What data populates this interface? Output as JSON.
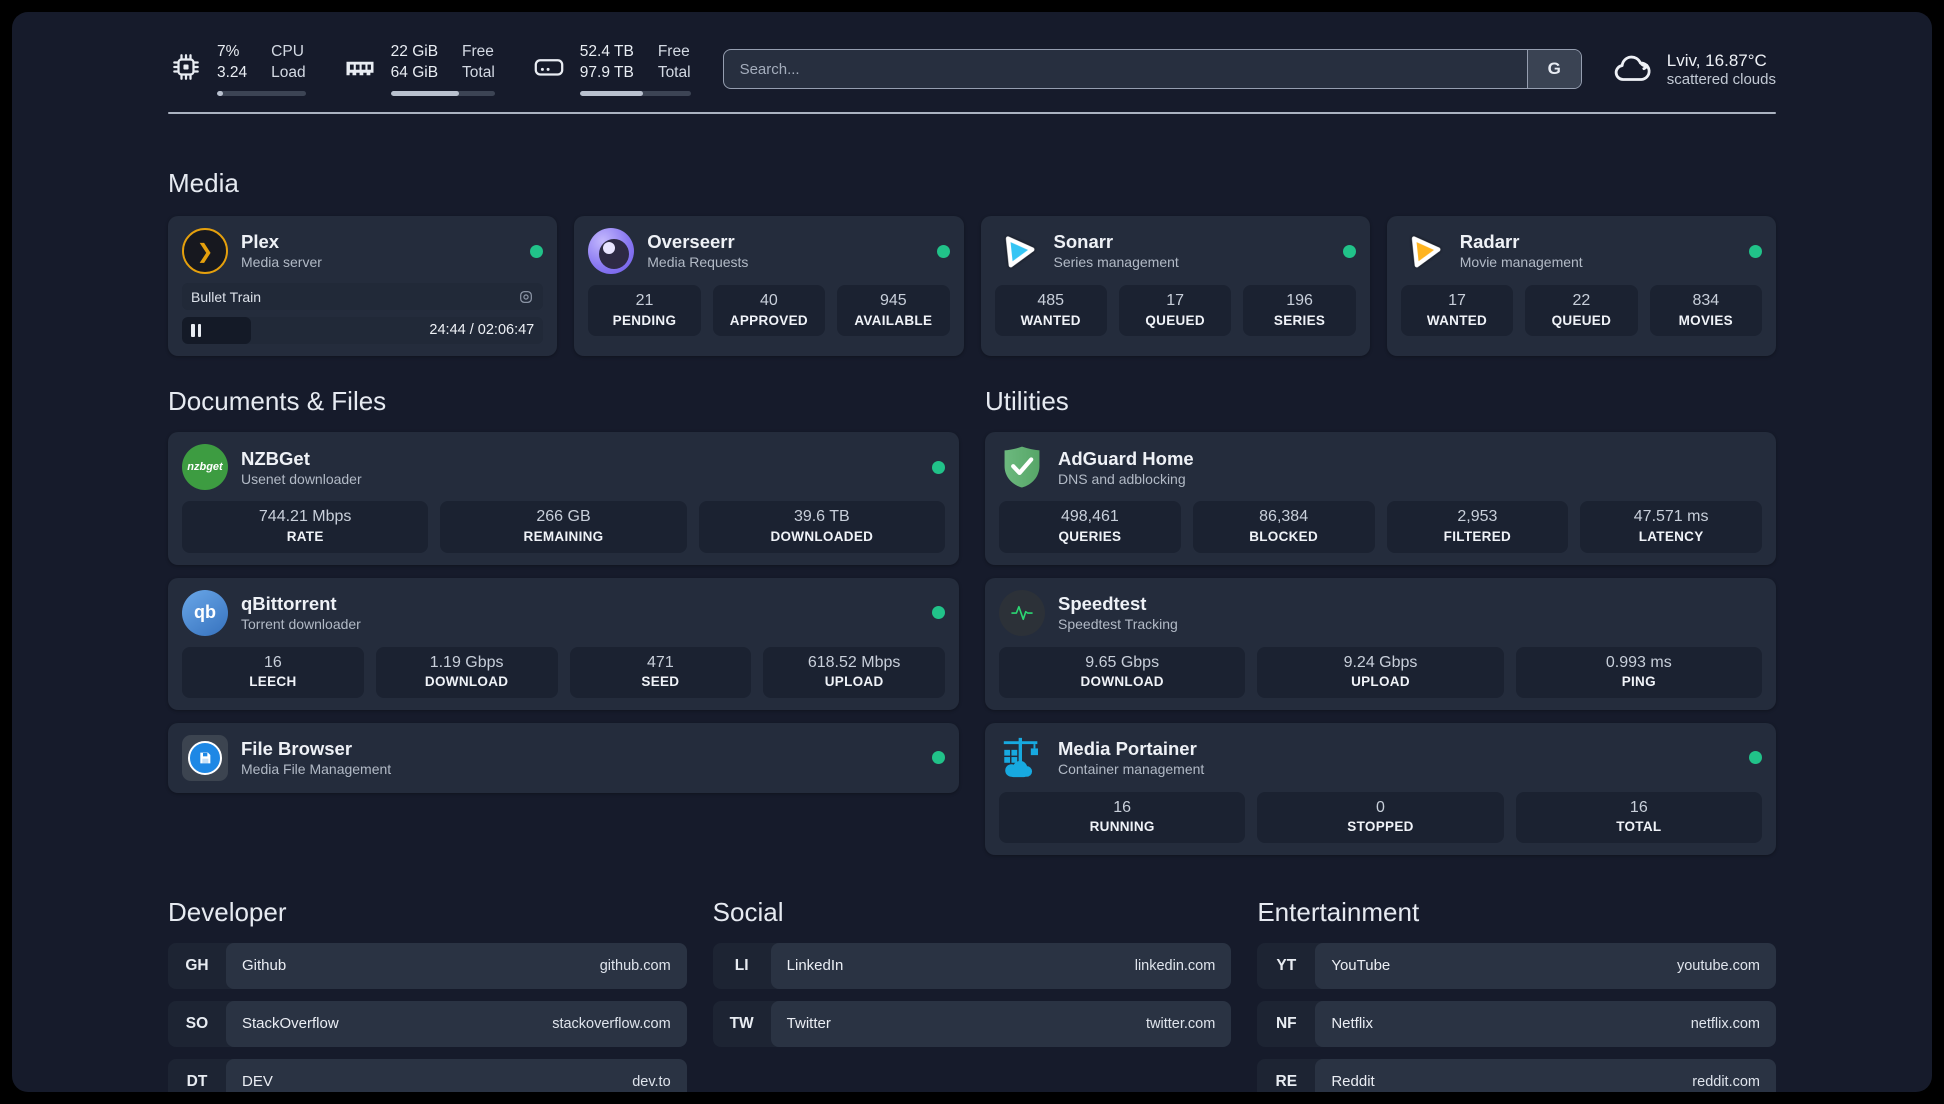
{
  "header": {
    "system_stats": [
      {
        "icon": "cpu-icon",
        "line1": "7%",
        "line2": "3.24",
        "label1": "CPU",
        "label2": "Load",
        "progress_pct": 7
      },
      {
        "icon": "ram-icon",
        "line1": "22 GiB",
        "line2": "64 GiB",
        "label1": "Free",
        "label2": "Total",
        "progress_pct": 66
      },
      {
        "icon": "disk-icon",
        "line1": "52.4 TB",
        "line2": "97.9 TB",
        "label1": "Free",
        "label2": "Total",
        "progress_pct": 57
      }
    ],
    "search": {
      "placeholder": "Search...",
      "provider_button": "G"
    },
    "weather": {
      "icon": "cloud-icon",
      "location": "Lviv, 16.87°C",
      "condition": "scattered clouds"
    }
  },
  "colors": {
    "accent_green": "#21c289",
    "canvas": "#161b2b",
    "card": "#242c3c",
    "stat_box": "#1b2231"
  },
  "media": {
    "title": "Media",
    "plex": {
      "name": "Plex",
      "desc": "Media server",
      "online": true,
      "now_playing": {
        "title": "Bullet Train",
        "time": "24:44 / 02:06:47",
        "progress_pct": 19,
        "state": "paused"
      }
    },
    "overseerr": {
      "name": "Overseerr",
      "desc": "Media Requests",
      "online": true,
      "stats": [
        {
          "value": "21",
          "label": "PENDING"
        },
        {
          "value": "40",
          "label": "APPROVED"
        },
        {
          "value": "945",
          "label": "AVAILABLE"
        }
      ]
    },
    "sonarr": {
      "name": "Sonarr",
      "desc": "Series management",
      "online": true,
      "stats": [
        {
          "value": "485",
          "label": "WANTED"
        },
        {
          "value": "17",
          "label": "QUEUED"
        },
        {
          "value": "196",
          "label": "SERIES"
        }
      ]
    },
    "radarr": {
      "name": "Radarr",
      "desc": "Movie management",
      "online": true,
      "stats": [
        {
          "value": "17",
          "label": "WANTED"
        },
        {
          "value": "22",
          "label": "QUEUED"
        },
        {
          "value": "834",
          "label": "MOVIES"
        }
      ]
    }
  },
  "documents": {
    "title": "Documents & Files",
    "nzbget": {
      "name": "NZBGet",
      "desc": "Usenet downloader",
      "online": true,
      "icon_text": "nzbget",
      "stats": [
        {
          "value": "744.21 Mbps",
          "label": "RATE"
        },
        {
          "value": "266 GB",
          "label": "REMAINING"
        },
        {
          "value": "39.6 TB",
          "label": "DOWNLOADED"
        }
      ]
    },
    "qbittorrent": {
      "name": "qBittorrent",
      "desc": "Torrent downloader",
      "online": true,
      "icon_text": "qb",
      "stats": [
        {
          "value": "16",
          "label": "LEECH"
        },
        {
          "value": "1.19 Gbps",
          "label": "DOWNLOAD"
        },
        {
          "value": "471",
          "label": "SEED"
        },
        {
          "value": "618.52 Mbps",
          "label": "UPLOAD"
        }
      ]
    },
    "filebrowser": {
      "name": "File Browser",
      "desc": "Media File Management",
      "online": true
    }
  },
  "utilities": {
    "title": "Utilities",
    "adguard": {
      "name": "AdGuard Home",
      "desc": "DNS and adblocking",
      "stats": [
        {
          "value": "498,461",
          "label": "QUERIES"
        },
        {
          "value": "86,384",
          "label": "BLOCKED"
        },
        {
          "value": "2,953",
          "label": "FILTERED"
        },
        {
          "value": "47.571 ms",
          "label": "LATENCY"
        }
      ]
    },
    "speedtest": {
      "name": "Speedtest",
      "desc": "Speedtest Tracking",
      "stats": [
        {
          "value": "9.65 Gbps",
          "label": "DOWNLOAD"
        },
        {
          "value": "9.24 Gbps",
          "label": "UPLOAD"
        },
        {
          "value": "0.993 ms",
          "label": "PING"
        }
      ]
    },
    "portainer": {
      "name": "Media Portainer",
      "desc": "Container management",
      "online": true,
      "stats": [
        {
          "value": "16",
          "label": "RUNNING"
        },
        {
          "value": "0",
          "label": "STOPPED"
        },
        {
          "value": "16",
          "label": "TOTAL"
        }
      ]
    }
  },
  "bookmarks": {
    "developer": {
      "title": "Developer",
      "links": [
        {
          "abbr": "GH",
          "name": "Github",
          "url": "github.com"
        },
        {
          "abbr": "SO",
          "name": "StackOverflow",
          "url": "stackoverflow.com"
        },
        {
          "abbr": "DT",
          "name": "DEV",
          "url": "dev.to"
        }
      ]
    },
    "social": {
      "title": "Social",
      "links": [
        {
          "abbr": "LI",
          "name": "LinkedIn",
          "url": "linkedin.com"
        },
        {
          "abbr": "TW",
          "name": "Twitter",
          "url": "twitter.com"
        }
      ]
    },
    "entertainment": {
      "title": "Entertainment",
      "links": [
        {
          "abbr": "YT",
          "name": "YouTube",
          "url": "youtube.com"
        },
        {
          "abbr": "NF",
          "name": "Netflix",
          "url": "netflix.com"
        },
        {
          "abbr": "RE",
          "name": "Reddit",
          "url": "reddit.com"
        }
      ]
    }
  }
}
